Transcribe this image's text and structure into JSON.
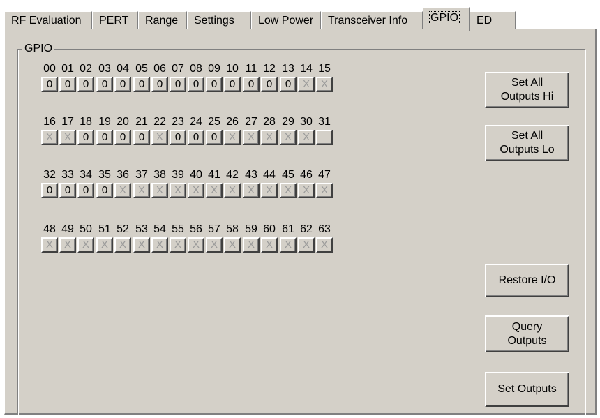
{
  "tabs": [
    {
      "label": "RF Evaluation",
      "active": false
    },
    {
      "label": "PERT",
      "active": false
    },
    {
      "label": "Range",
      "active": false
    },
    {
      "label": "Settings",
      "active": false
    },
    {
      "label": "Low Power",
      "active": false
    },
    {
      "label": "Transceiver Info",
      "active": false
    },
    {
      "label": "GPIO",
      "active": true
    },
    {
      "label": "ED",
      "active": false
    }
  ],
  "group_label": "GPIO",
  "pins": [
    {
      "num": "00",
      "state": "0"
    },
    {
      "num": "01",
      "state": "0"
    },
    {
      "num": "02",
      "state": "0"
    },
    {
      "num": "03",
      "state": "0"
    },
    {
      "num": "04",
      "state": "0"
    },
    {
      "num": "05",
      "state": "0"
    },
    {
      "num": "06",
      "state": "0"
    },
    {
      "num": "07",
      "state": "0"
    },
    {
      "num": "08",
      "state": "0"
    },
    {
      "num": "09",
      "state": "0"
    },
    {
      "num": "10",
      "state": "0"
    },
    {
      "num": "11",
      "state": "0"
    },
    {
      "num": "12",
      "state": "0"
    },
    {
      "num": "13",
      "state": "0"
    },
    {
      "num": "14",
      "state": "X"
    },
    {
      "num": "15",
      "state": "X"
    },
    {
      "num": "16",
      "state": "X"
    },
    {
      "num": "17",
      "state": "X"
    },
    {
      "num": "18",
      "state": "0"
    },
    {
      "num": "19",
      "state": "0"
    },
    {
      "num": "20",
      "state": "0"
    },
    {
      "num": "21",
      "state": "0"
    },
    {
      "num": "22",
      "state": "X"
    },
    {
      "num": "23",
      "state": "0"
    },
    {
      "num": "24",
      "state": "0"
    },
    {
      "num": "25",
      "state": "0"
    },
    {
      "num": "26",
      "state": "X"
    },
    {
      "num": "27",
      "state": "X"
    },
    {
      "num": "28",
      "state": "X"
    },
    {
      "num": "29",
      "state": "X"
    },
    {
      "num": "30",
      "state": "X"
    },
    {
      "num": "31",
      "state": ""
    },
    {
      "num": "32",
      "state": "0"
    },
    {
      "num": "33",
      "state": "0"
    },
    {
      "num": "34",
      "state": "0"
    },
    {
      "num": "35",
      "state": "0"
    },
    {
      "num": "36",
      "state": "X"
    },
    {
      "num": "37",
      "state": "X"
    },
    {
      "num": "38",
      "state": "X"
    },
    {
      "num": "39",
      "state": "X"
    },
    {
      "num": "40",
      "state": "X"
    },
    {
      "num": "41",
      "state": "X"
    },
    {
      "num": "42",
      "state": "X"
    },
    {
      "num": "43",
      "state": "X"
    },
    {
      "num": "44",
      "state": "X"
    },
    {
      "num": "45",
      "state": "X"
    },
    {
      "num": "46",
      "state": "X"
    },
    {
      "num": "47",
      "state": "X"
    },
    {
      "num": "48",
      "state": "X"
    },
    {
      "num": "49",
      "state": "X"
    },
    {
      "num": "50",
      "state": "X"
    },
    {
      "num": "51",
      "state": "X"
    },
    {
      "num": "52",
      "state": "X"
    },
    {
      "num": "53",
      "state": "X"
    },
    {
      "num": "54",
      "state": "X"
    },
    {
      "num": "55",
      "state": "X"
    },
    {
      "num": "56",
      "state": "X"
    },
    {
      "num": "57",
      "state": "X"
    },
    {
      "num": "58",
      "state": "X"
    },
    {
      "num": "59",
      "state": "X"
    },
    {
      "num": "60",
      "state": "X"
    },
    {
      "num": "61",
      "state": "X"
    },
    {
      "num": "62",
      "state": "X"
    },
    {
      "num": "63",
      "state": "X"
    }
  ],
  "buttons": {
    "set_all_hi": "Set All\nOutputs Hi",
    "set_all_lo": "Set All\nOutputs Lo",
    "restore_io": "Restore I/O",
    "query_outputs": "Query\nOutputs",
    "set_outputs": "Set Outputs"
  },
  "colors": {
    "face": "#d4d0c8",
    "disabled_text": "#9a9a9a"
  }
}
